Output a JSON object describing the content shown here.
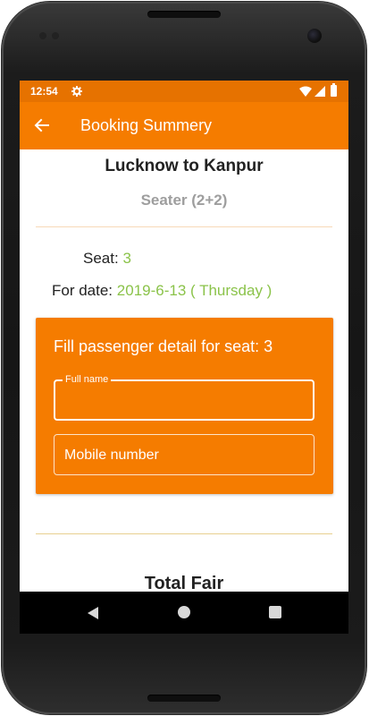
{
  "status_bar": {
    "time": "12:54",
    "icons": [
      "gear-icon",
      "wifi-icon",
      "signal-icon",
      "battery-icon"
    ]
  },
  "app_bar": {
    "title": "Booking Summery",
    "back_icon": "arrow-left-icon",
    "color": "#f57c00"
  },
  "summary": {
    "route": "Lucknow to Kanpur",
    "bus_type": "Seater (2+2)",
    "seat_label": "Seat:",
    "seat_value": "3",
    "date_label": "For date:",
    "date_value": "2019-6-13 ( Thursday )",
    "accent_color": "#8bc34a"
  },
  "passenger_form": {
    "title": "Fill passenger detail for seat: 3",
    "full_name_label": "Full name",
    "full_name_value": "",
    "mobile_placeholder": "Mobile number",
    "card_color": "#f57c00"
  },
  "total": {
    "title": "Total Fair"
  },
  "nav_bar": {
    "icons": [
      "nav-back-icon",
      "nav-home-icon",
      "nav-recents-icon"
    ]
  }
}
